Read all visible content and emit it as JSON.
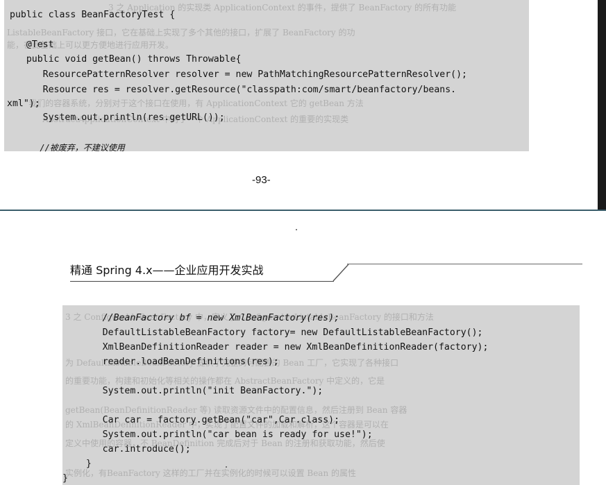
{
  "top_page": {
    "code_lines": [
      "public class BeanFactoryTest {",
      "   @Test",
      "   public void getBean() throws Throwable{",
      "      ResourcePatternResolver resolver = new PathMatchingResourcePatternResolver();",
      "      Resource res = resolver.getResource(\"classpath:com/smart/beanfactory/beans.",
      "xml\");",
      "      System.out.println(res.getURL());",
      "      //被废弃，不建议使用"
    ],
    "ghost_lines": [
      "3 之 Application 的实现类 ApplicationContext 的事件，提供了 BeanFactory 的所有功能",
      "ListableBeanFactory 接口，它在基础上实现了多个其他的接口，扩展了 BeanFactory 的功",
      "能，在此基础上可以更方便地进行应用开发。",
      "    我们的容器系统，分别对于这个接口在使用，有 ApplicationContext 它的 getBean 方法",
      "    AbstractApplicationContext 中对于一个 ApplicationContext 的重要的实现类"
    ],
    "page_number": "-93-"
  },
  "bottom_page": {
    "book_title": "精通 Spring 4.x——企业应用开发实战",
    "code_lines": [
      "      //BeanFactory bf = new XmlBeanFactory(res);",
      "      DefaultListableBeanFactory factory= new DefaultListableBeanFactory();",
      "      XmlBeanDefinitionReader reader = new XmlBeanDefinitionReader(factory);",
      "      reader.loadBeanDefinitions(res);",
      "",
      "      System.out.println(\"init BeanFactory.\");",
      "",
      "      Car car = factory.getBean(\"car\",Car.class);",
      "      System.out.println(\"car bean is ready for use!\");",
      "      car.introduce();",
      "   }",
      "}"
    ],
    "ghost_lines": [
      "3 之 ConfigurableBeanFactory 中，定义了 ConfigurableListableBeanFactory 的接口和方法",
      "为 DefaultListableBeanFactory 提供了完整的可配置的 Bean 工厂，它实现了各种接口",
      "的重要功能，构建和初始化等相关的操作都在 AbstractBeanFactory 中定义的，它是",
      "getBean(BeanDefinitionReader 等) 读取资源文件中的配置信息，然后注册到 Bean 容器",
      "的 XmlBeanDefinitionReader 中，实现了配置文件的加载和解析，这个容器是可以在",
      "定义中使用的容器，不 BeanDefinition 完成后对于 Bean 的注册和获取功能，然后使",
      "实例化，有BeanFactory 这样的工厂并在实例化的时候可以设置 Bean 的属性"
    ]
  }
}
